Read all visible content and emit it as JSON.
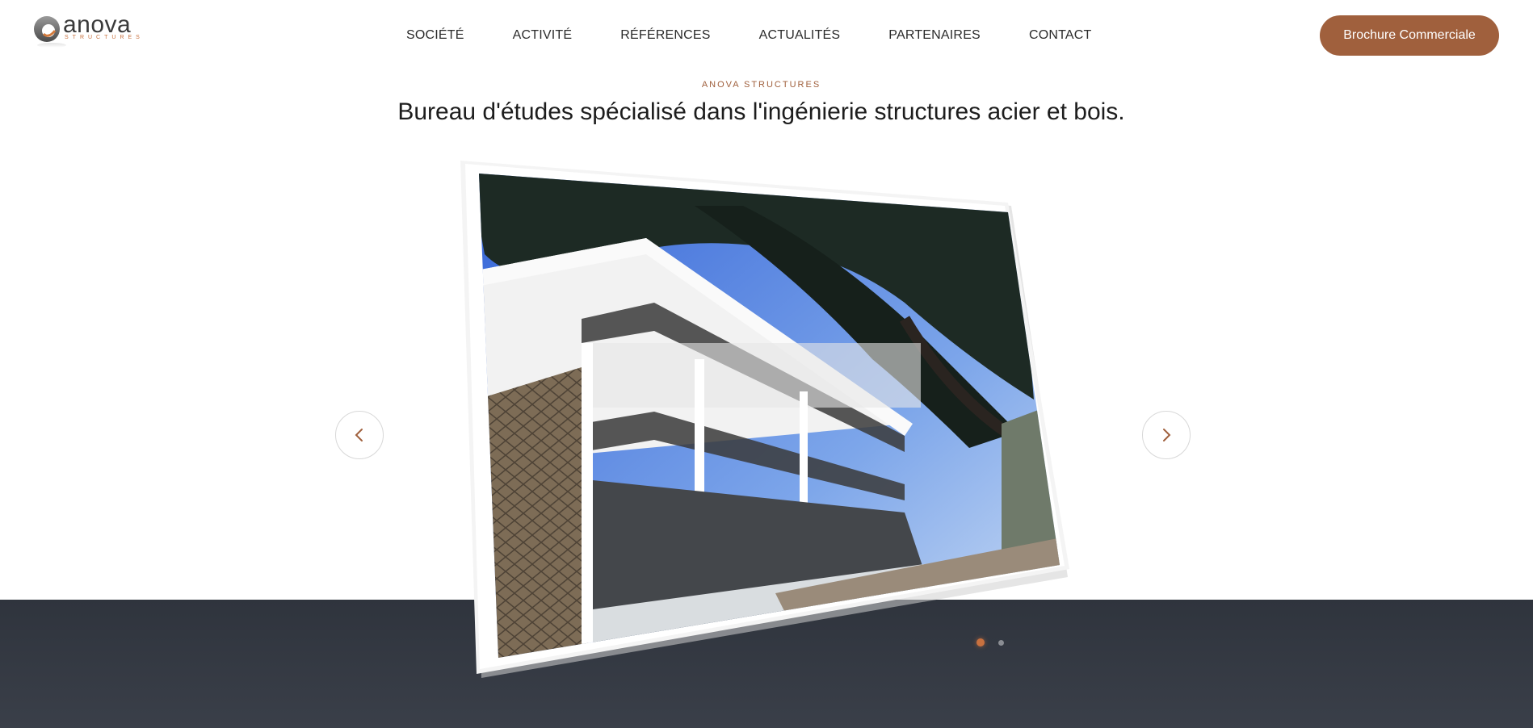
{
  "brand": {
    "name": "anova",
    "tagline": "STRUCTURES",
    "colors": {
      "accent": "#a0603d",
      "dark_band": "#2f343d",
      "text": "#222222"
    }
  },
  "nav": {
    "items": [
      {
        "label": "SOCIÉTÉ"
      },
      {
        "label": "ACTIVITÉ"
      },
      {
        "label": "RÉFÉRENCES"
      },
      {
        "label": "ACTUALITÉS"
      },
      {
        "label": "PARTENAIRES"
      },
      {
        "label": "CONTACT"
      }
    ]
  },
  "header": {
    "cta_label": "Brochure Commerciale"
  },
  "hero": {
    "eyebrow": "ANOVA STRUCTURES",
    "headline": "Bureau d'études spécialisé dans l'ingénierie structures acier et bois."
  },
  "slider": {
    "slide_count": 2,
    "active_index": 0,
    "prev_icon": "chevron-left-icon",
    "next_icon": "chevron-right-icon"
  }
}
